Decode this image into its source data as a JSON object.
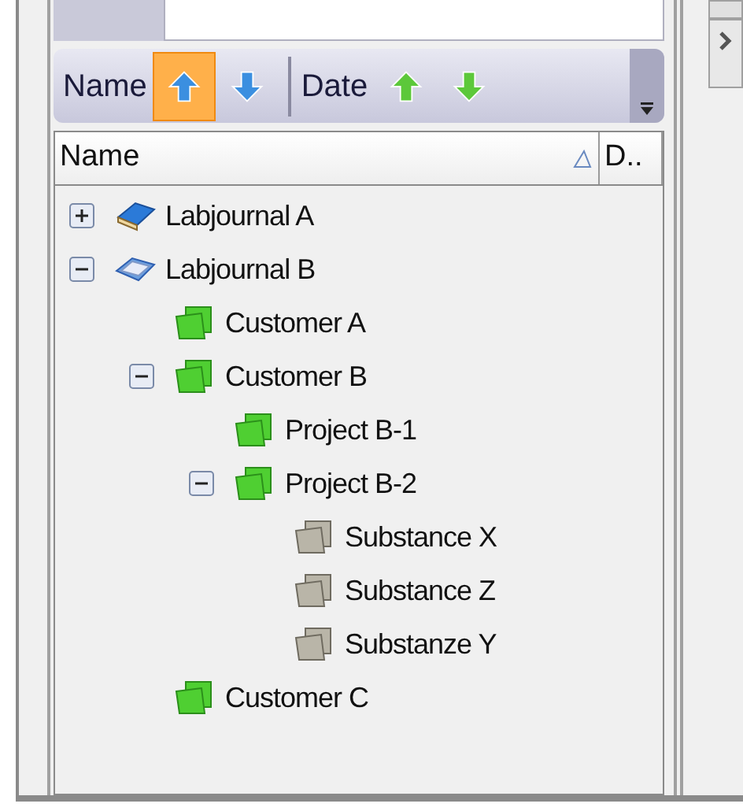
{
  "sort_toolbar": [
    {
      "label": "Name",
      "color": "#3b8fe0",
      "buttons": [
        {
          "kind": "up",
          "selected": true
        },
        {
          "kind": "down",
          "selected": false
        }
      ]
    },
    {
      "label": "Date",
      "color": "#5cc83a",
      "buttons": [
        {
          "kind": "up",
          "selected": false
        },
        {
          "kind": "down",
          "selected": false
        }
      ]
    }
  ],
  "columns": [
    {
      "label": "Name",
      "sorted": true
    },
    {
      "label": "D..",
      "sorted": false
    }
  ],
  "tree": [
    {
      "label": "Labjournal A",
      "kind": "journal",
      "expanded": false
    },
    {
      "label": "Labjournal B",
      "kind": "journal",
      "expanded": true,
      "children": [
        {
          "label": "Customer A",
          "kind": "customer"
        },
        {
          "label": "Customer B",
          "kind": "customer",
          "expanded": true,
          "children": [
            {
              "label": "Project B-1",
              "kind": "project"
            },
            {
              "label": "Project B-2",
              "kind": "project",
              "expanded": true,
              "children": [
                {
                  "label": "Substance X",
                  "kind": "substance"
                },
                {
                  "label": "Substance Z",
                  "kind": "substance"
                },
                {
                  "label": "Substanze Y",
                  "kind": "substance"
                }
              ]
            }
          ]
        },
        {
          "label": "Customer C",
          "kind": "customer"
        }
      ]
    }
  ]
}
